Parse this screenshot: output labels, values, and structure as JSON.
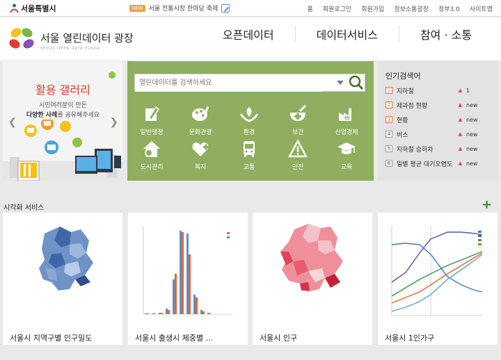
{
  "topbar": {
    "seoul_logo": "서울특별시",
    "news_tag": "NEW",
    "news_text": "서울 전통시장 한마당 축제",
    "links": [
      "홈",
      "회원로그인",
      "회원가입",
      "정보소통광장",
      "정부3.0",
      "사이트맵"
    ]
  },
  "header": {
    "site_name": "서울 열린데이터 광장",
    "site_sub": "SEOUL OPEN DATA PLAZA",
    "nav": [
      "오픈데이터",
      "데이터서비스",
      "참여 · 소통"
    ]
  },
  "gallery": {
    "title": "활용 갤러리",
    "desc_line1": "시민여러분이 만든",
    "desc_line2_strong": "다양한 사례",
    "desc_line2_rest": "를 공유해주세요"
  },
  "search": {
    "placeholder": "열린데이터를 검색하세요",
    "categories": [
      "일반행정",
      "문화관광",
      "환경",
      "보건",
      "산업경제",
      "도시관리",
      "복지",
      "교통",
      "안전",
      "교육"
    ]
  },
  "popular": {
    "title": "인기검색어",
    "items": [
      {
        "rank": "1",
        "name": "지하철",
        "status": "1",
        "up": true
      },
      {
        "rank": "2",
        "name": "제과점 현황",
        "status": "new",
        "up": true
      },
      {
        "rank": "3",
        "name": "현황",
        "status": "new",
        "up": true
      },
      {
        "rank": "4",
        "name": "버스",
        "status": "new",
        "up": true
      },
      {
        "rank": "5",
        "name": "지하철 승하차",
        "status": "new",
        "up": true
      },
      {
        "rank": "6",
        "name": "일별 평균 대기오염도",
        "status": "new",
        "up": true
      }
    ]
  },
  "visual": {
    "title": "시각화 서비스",
    "more": "+",
    "cards": [
      "서울시 지역구별 인구밀도",
      "서울시 출생시 체중별 ...",
      "서울시 인구",
      "서울시 1인가구"
    ]
  },
  "colors": {
    "green_panel": "#8fae5f",
    "accent_red": "#e03c31",
    "bar_blue": "#5b8fc9",
    "bar_orange": "#e8652a"
  },
  "icons": [
    "search-icon",
    "caret-down-icon",
    "chevron-left-icon",
    "chevron-right-icon",
    "plus-icon",
    "edit-icon"
  ]
}
